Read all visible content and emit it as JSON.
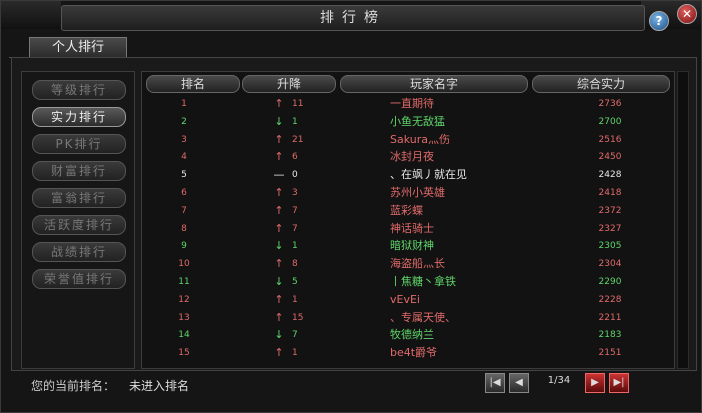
{
  "window": {
    "title": "排行榜",
    "help": "?",
    "close": "✕"
  },
  "tab": {
    "label": "个人排行"
  },
  "sidebar": {
    "items": [
      {
        "label": "等级排行",
        "active": false
      },
      {
        "label": "实力排行",
        "active": true
      },
      {
        "label": "PK排行",
        "active": false
      },
      {
        "label": "财富排行",
        "active": false
      },
      {
        "label": "富翁排行",
        "active": false
      },
      {
        "label": "活跃度排行",
        "active": false
      },
      {
        "label": "战绩排行",
        "active": false
      },
      {
        "label": "荣誉值排行",
        "active": false
      }
    ]
  },
  "table": {
    "headers": {
      "rank": "排名",
      "change": "升降",
      "name": "玩家名字",
      "power": "综合实力"
    },
    "rows": [
      {
        "rank": "1",
        "arrow": "↑",
        "delta": "11",
        "name": "一直期待",
        "power": "2736",
        "color": "#e06a6a"
      },
      {
        "rank": "2",
        "arrow": "↓",
        "delta": "1",
        "name": "小鱼无敌猛",
        "power": "2700",
        "color": "#5fd46a"
      },
      {
        "rank": "3",
        "arrow": "↑",
        "delta": "21",
        "name": "Sakura灬伤",
        "power": "2516",
        "color": "#e06a6a"
      },
      {
        "rank": "4",
        "arrow": "↑",
        "delta": "6",
        "name": "冰封月夜",
        "power": "2450",
        "color": "#e06a6a"
      },
      {
        "rank": "5",
        "arrow": "—",
        "delta": "0",
        "name": "、在飒丿就在见",
        "power": "2428",
        "color": "#e8e8e8"
      },
      {
        "rank": "6",
        "arrow": "↑",
        "delta": "3",
        "name": "苏州小英雄",
        "power": "2418",
        "color": "#e06a6a"
      },
      {
        "rank": "7",
        "arrow": "↑",
        "delta": "7",
        "name": "蓝彩蝶",
        "power": "2372",
        "color": "#e06a6a"
      },
      {
        "rank": "8",
        "arrow": "↑",
        "delta": "7",
        "name": "神话骑士",
        "power": "2327",
        "color": "#e06a6a"
      },
      {
        "rank": "9",
        "arrow": "↓",
        "delta": "1",
        "name": "暗狱财神",
        "power": "2305",
        "color": "#5fd46a"
      },
      {
        "rank": "10",
        "arrow": "↑",
        "delta": "8",
        "name": "海盗船灬长",
        "power": "2304",
        "color": "#e06a6a"
      },
      {
        "rank": "11",
        "arrow": "↓",
        "delta": "5",
        "name": "丨焦糖丶拿铁",
        "power": "2290",
        "color": "#5fd46a"
      },
      {
        "rank": "12",
        "arrow": "↑",
        "delta": "1",
        "name": "vEvEi",
        "power": "2228",
        "color": "#e06a6a"
      },
      {
        "rank": "13",
        "arrow": "↑",
        "delta": "15",
        "name": "、专属天使、",
        "power": "2211",
        "color": "#e06a6a"
      },
      {
        "rank": "14",
        "arrow": "↓",
        "delta": "7",
        "name": "牧德纳兰",
        "power": "2183",
        "color": "#5fd46a"
      },
      {
        "rank": "15",
        "arrow": "↑",
        "delta": "1",
        "name": "be4t爵爷",
        "power": "2151",
        "color": "#e06a6a"
      }
    ]
  },
  "footer": {
    "label": "您的当前排名：",
    "value": "未进入排名",
    "page": "1/34"
  }
}
